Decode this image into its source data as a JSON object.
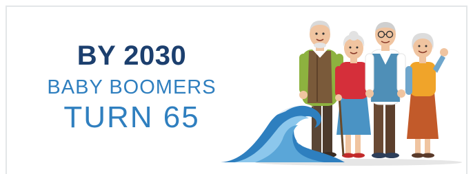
{
  "banner": {
    "headline": "BY 2030",
    "subline_1": "BABY BOOMERS",
    "subline_2": "TURN 65"
  },
  "colors": {
    "headline": "#1c3f6e",
    "subline": "#2f7fbf",
    "wave_dark": "#2e7fbf",
    "wave_light": "#8cc7ec"
  },
  "illustration": {
    "icon": "elderly-group-with-wave-illustration"
  }
}
